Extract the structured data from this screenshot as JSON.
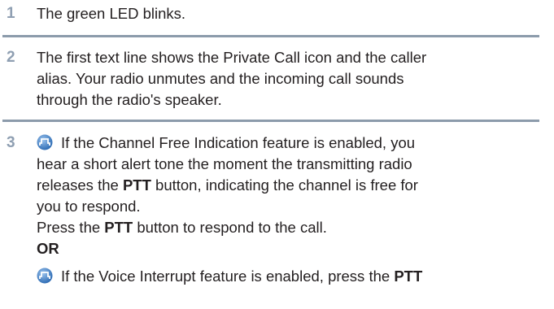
{
  "steps": [
    {
      "number": "1",
      "text": "The green LED blinks."
    },
    {
      "number": "2",
      "lines": [
        "The first text line shows the Private Call icon and the caller",
        "alias. Your radio unmutes and the incoming call sounds",
        "through the radio's speaker."
      ]
    },
    {
      "number": "3",
      "icon": "channel-free-indication-icon",
      "line1": "If the Channel Free Indication feature is enabled, you",
      "line2": "hear a short alert tone the moment the transmitting radio",
      "line3_pre": "releases the ",
      "line3_bold": "PTT",
      "line3_post": " button, indicating the channel is free for",
      "line4": "you to respond.",
      "line5_pre": "Press the ",
      "line5_bold": "PTT",
      "line5_post": " button to respond to the call.",
      "or_label": "OR",
      "icon2": "voice-interrupt-icon",
      "line6_pre": "If the Voice Interrupt feature is enabled, press the ",
      "line6_bold": "PTT"
    }
  ],
  "colors": {
    "step_number": "#8f9fb2",
    "rule": "#8c9bab",
    "icon_fill": "#4a7fc0",
    "text": "#231f20"
  }
}
